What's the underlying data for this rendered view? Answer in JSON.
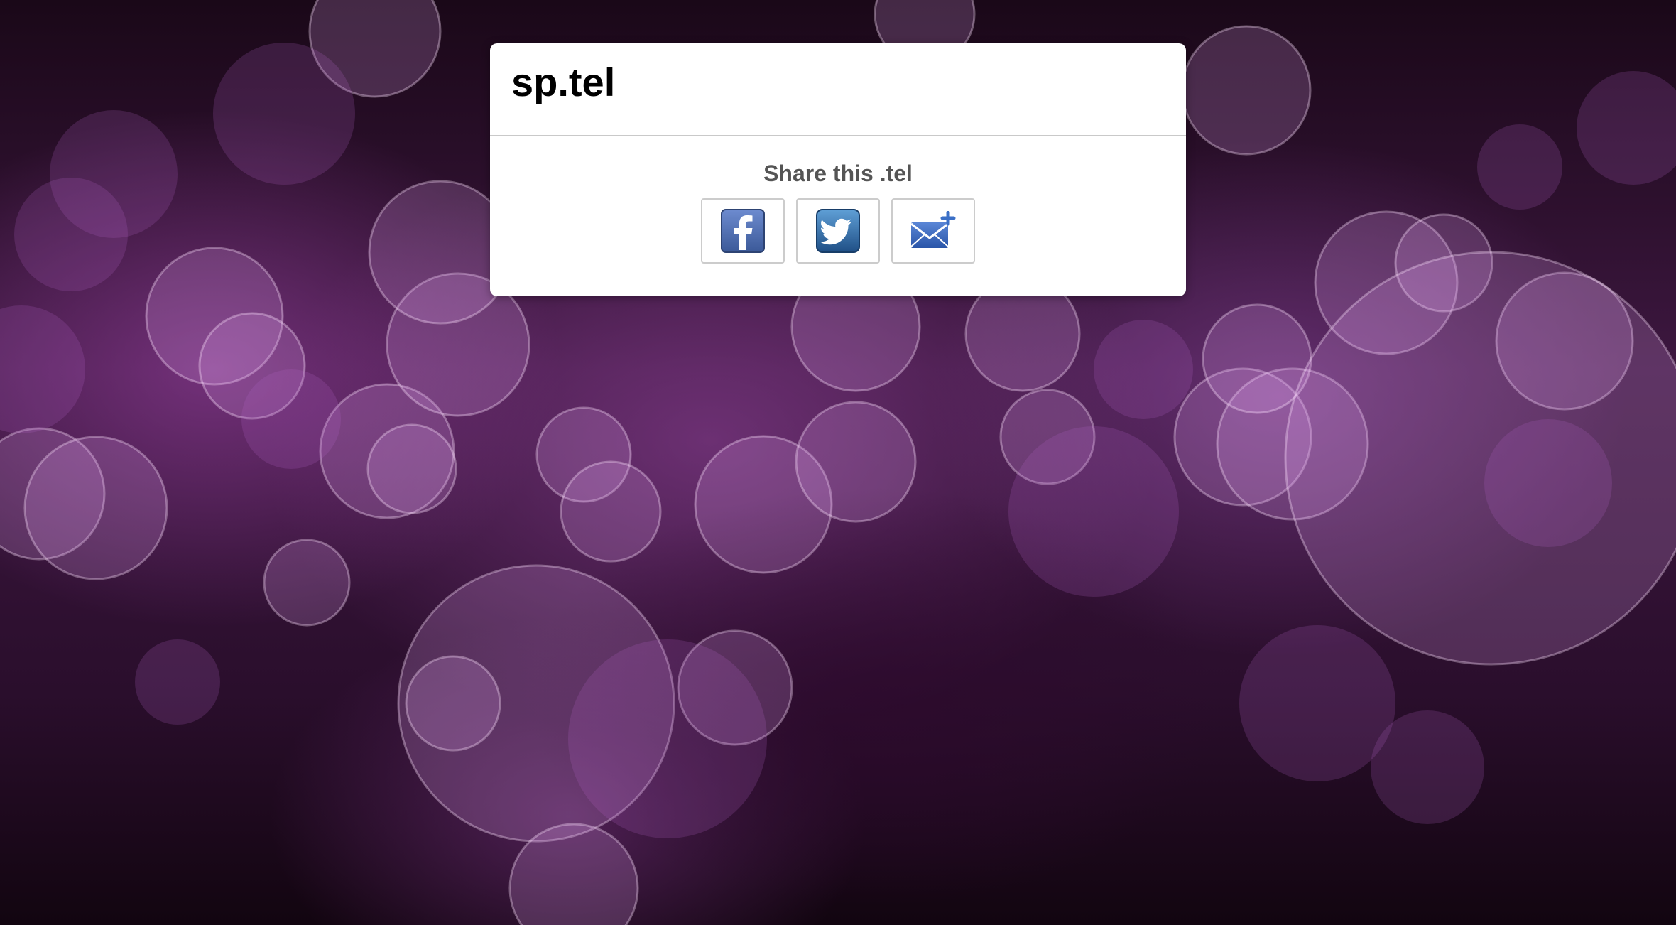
{
  "page": {
    "site_title": "sp.tel",
    "share_heading": "Share this .tel"
  },
  "share_buttons": [
    {
      "name": "facebook",
      "icon": "facebook-icon",
      "color": "#3b5998"
    },
    {
      "name": "twitter",
      "icon": "twitter-icon",
      "color": "#2a6aa8"
    },
    {
      "name": "email",
      "icon": "email-add-icon",
      "color": "#2f5fb0"
    }
  ],
  "colors": {
    "background": "#3d1740",
    "card": "#ffffff",
    "title_text": "#000000",
    "share_text": "#555555"
  }
}
